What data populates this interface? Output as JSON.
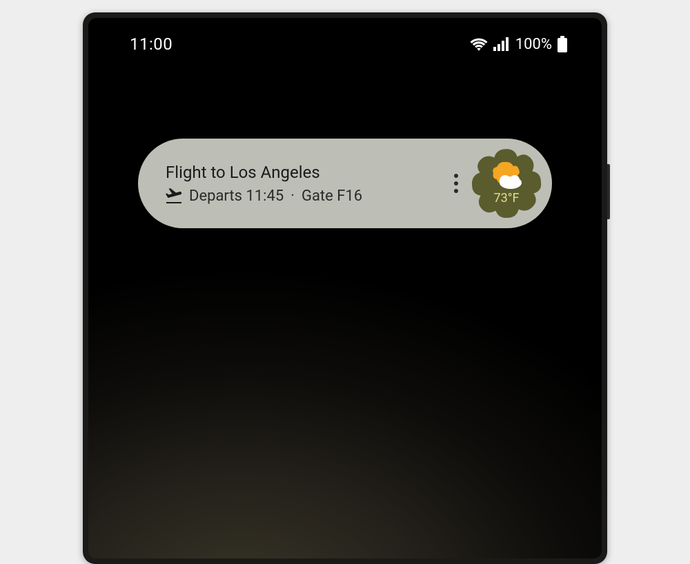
{
  "status_bar": {
    "time": "11:00",
    "battery_percent": "100%"
  },
  "widget": {
    "title": "Flight to Los Angeles",
    "departs_label": "Departs 11:45",
    "separator": "·",
    "gate_label": "Gate F16"
  },
  "weather": {
    "temperature": "73°F"
  }
}
